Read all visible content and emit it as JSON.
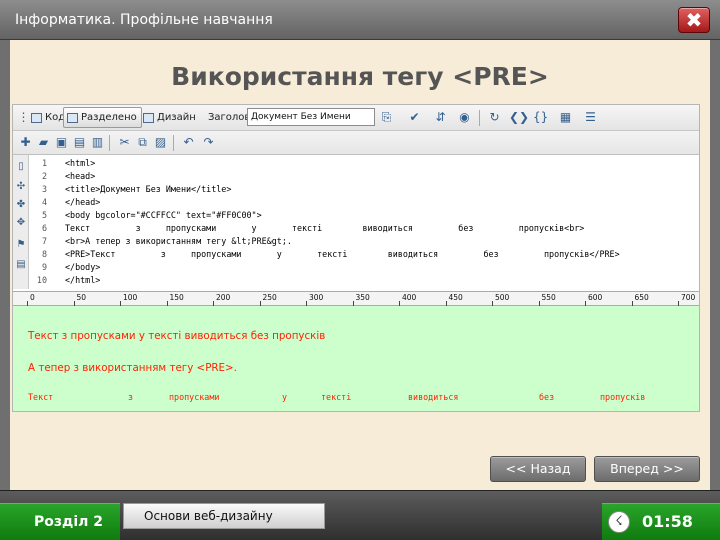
{
  "header": {
    "title": "Інформатика. Профільне навчання",
    "icon": "book-icon",
    "close_label": "✖"
  },
  "slide": {
    "title": "Використання тегу <PRE>"
  },
  "editor": {
    "view_tabs": [
      "Код",
      "Разделено",
      "Дизайн"
    ],
    "active_view": "Разделено",
    "title_label": "Заголовок:",
    "title_value": "Документ Без Имени",
    "code_lines": [
      {
        "num": "1",
        "text": "<html>"
      },
      {
        "num": "2",
        "text": "<head>"
      },
      {
        "num": "3",
        "text": "<title>Документ Без Имени</title>"
      },
      {
        "num": "4",
        "text": "</head>"
      },
      {
        "num": "5",
        "text": "<body bgcolor=\"#CCFFCC\" text=\"#FF0C00\">"
      },
      {
        "num": "6",
        "text": "Текст         з     пропусками       у       тексті        виводиться         без         пропусків<br>"
      },
      {
        "num": "7",
        "text": "<br>А тепер з використанням тегу &lt;PRE&gt;."
      },
      {
        "num": "8",
        "text": "<PRE>Текст         з     пропусками       у       тексті        виводиться         без         пропусків</PRE>"
      },
      {
        "num": "9",
        "text": "</body>"
      },
      {
        "num": "10",
        "text": "</html>"
      }
    ],
    "ruler_labels": [
      "0",
      "50",
      "100",
      "150",
      "200",
      "250",
      "300",
      "350",
      "400",
      "450",
      "500",
      "550",
      "600",
      "650",
      "700"
    ],
    "design_text_1": "Текст з пропусками у тексті виводиться без пропусків",
    "design_text_2": "А тепер з використанням тегу <PRE>.",
    "design_pre_words": [
      "Текст",
      "з",
      "пропусками",
      "у",
      "тексті",
      "виводиться",
      "без",
      "пропусків"
    ]
  },
  "nav": {
    "back_label": "<< Назад",
    "forward_label": "Вперед >>"
  },
  "footer": {
    "section_label": "Розділ 2",
    "section_icon": "chapter-icon",
    "topic_label": "Основи веб-дизайну",
    "topic_icon": "topic-icon",
    "timer": "01:58",
    "timer_icon": "clock-icon"
  },
  "colors": {
    "design_bg": "#CCFFCC",
    "design_text": "#FF2200",
    "slide_bg": "#F7ECD8",
    "accent_green": "#1A9A1A",
    "close_red": "#C02020"
  }
}
